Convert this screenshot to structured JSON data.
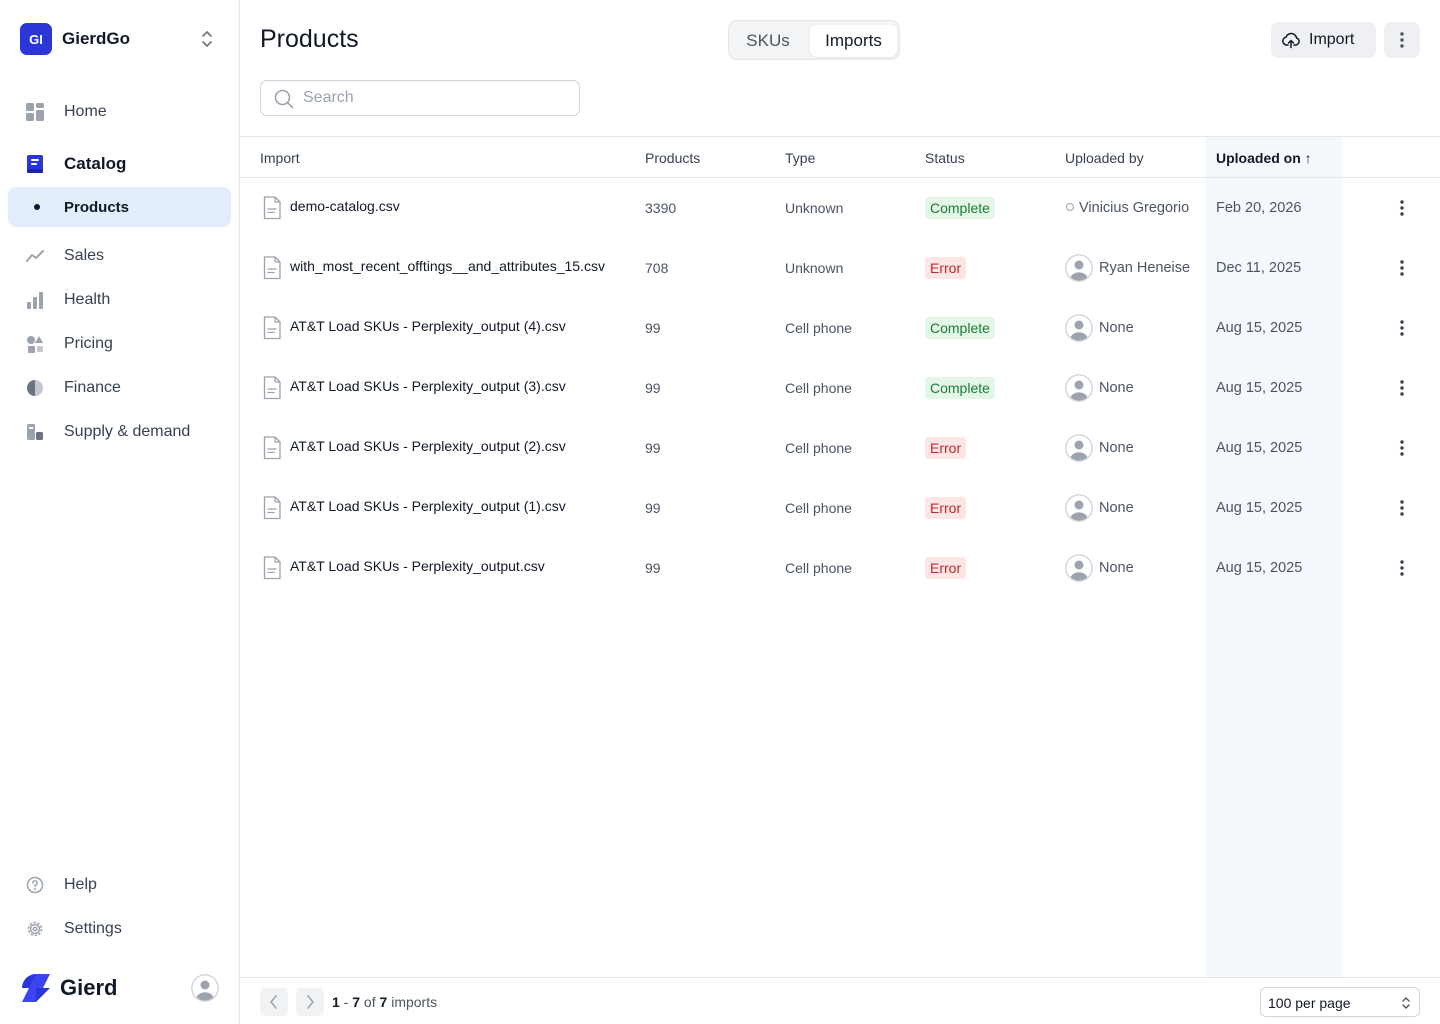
{
  "workspace": {
    "badge": "GI",
    "name": "GierdGo"
  },
  "sidebar": {
    "items": [
      {
        "label": "Home",
        "icon": "home-grid-icon"
      },
      {
        "label": "Catalog",
        "icon": "book-icon"
      },
      {
        "label": "Products",
        "icon": "dot-icon"
      },
      {
        "label": "Sales",
        "icon": "trend-line-icon"
      },
      {
        "label": "Health",
        "icon": "bar-chart-icon"
      },
      {
        "label": "Pricing",
        "icon": "shapes-icon"
      },
      {
        "label": "Finance",
        "icon": "pie-chart-icon"
      },
      {
        "label": "Supply & demand",
        "icon": "boxes-icon"
      }
    ],
    "bottom": [
      {
        "label": "Help",
        "icon": "help-circle-icon"
      },
      {
        "label": "Settings",
        "icon": "gear-icon"
      }
    ],
    "brand": "Gierd"
  },
  "header": {
    "title": "Products",
    "tabs": [
      {
        "label": "SKUs"
      },
      {
        "label": "Imports"
      }
    ],
    "import_label": "Import"
  },
  "search": {
    "placeholder": "Search",
    "value": ""
  },
  "table": {
    "columns": [
      "Import",
      "Products",
      "Type",
      "Status",
      "Uploaded by",
      "Uploaded on"
    ],
    "sort_indicator": "↑",
    "rows": [
      {
        "file": "demo-catalog.csv",
        "products": "3390",
        "type": "Unknown",
        "status": "Complete",
        "by": "Vinicius Gregorio",
        "on": "Feb 20, 2026"
      },
      {
        "file": "with_most_recent_offtings__and_attributes_15.csv",
        "products": "708",
        "type": "Unknown",
        "status": "Error",
        "by": "Ryan Heneise",
        "on": "Dec 11, 2025"
      },
      {
        "file": "AT&T Load SKUs - Perplexity_output (4).csv",
        "products": "99",
        "type": "Cell phone",
        "status": "Complete",
        "by": "None",
        "on": "Aug 15, 2025"
      },
      {
        "file": "AT&T Load SKUs - Perplexity_output (3).csv",
        "products": "99",
        "type": "Cell phone",
        "status": "Complete",
        "by": "None",
        "on": "Aug 15, 2025"
      },
      {
        "file": "AT&T Load SKUs - Perplexity_output (2).csv",
        "products": "99",
        "type": "Cell phone",
        "status": "Error",
        "by": "None",
        "on": "Aug 15, 2025"
      },
      {
        "file": "AT&T Load SKUs - Perplexity_output (1).csv",
        "products": "99",
        "type": "Cell phone",
        "status": "Error",
        "by": "None",
        "on": "Aug 15, 2025"
      },
      {
        "file": "AT&T Load SKUs - Perplexity_output.csv",
        "products": "99",
        "type": "Cell phone",
        "status": "Error",
        "by": "None",
        "on": "Aug 15, 2025"
      }
    ]
  },
  "pagination": {
    "start": "1",
    "sep": " - ",
    "end": "7",
    "of": " of ",
    "total": "7",
    "suffix": " imports",
    "per_page": "100 per page"
  },
  "colors": {
    "accent": "#2b35d8",
    "active_bg": "#e3eefc",
    "complete_bg": "#e4f6e8",
    "complete_fg": "#1c7c38",
    "error_bg": "#fde6e6",
    "error_fg": "#c22929"
  }
}
